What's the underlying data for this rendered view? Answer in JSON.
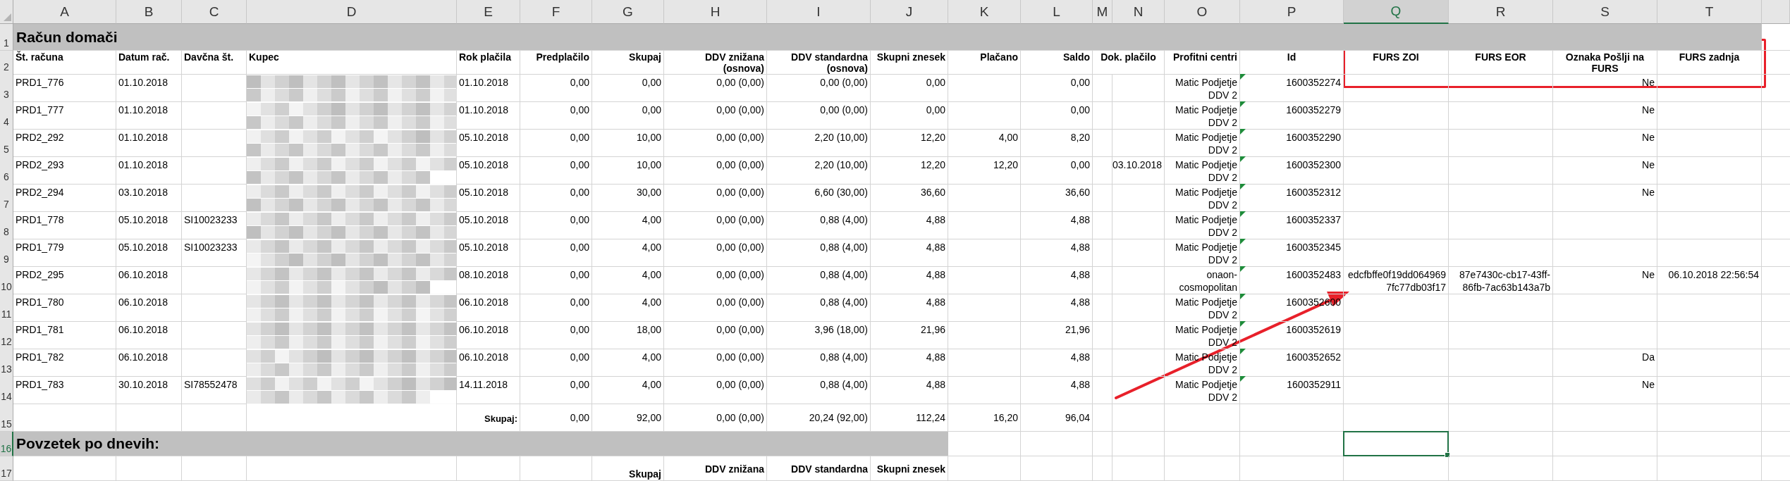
{
  "column_headers": [
    {
      "label": "A",
      "selected": false
    },
    {
      "label": "B",
      "selected": false
    },
    {
      "label": "C",
      "selected": false
    },
    {
      "label": "D",
      "selected": false
    },
    {
      "label": "E",
      "selected": false
    },
    {
      "label": "F",
      "selected": false
    },
    {
      "label": "G",
      "selected": false
    },
    {
      "label": "H",
      "selected": false
    },
    {
      "label": "I",
      "selected": false
    },
    {
      "label": "J",
      "selected": false
    },
    {
      "label": "K",
      "selected": false
    },
    {
      "label": "L",
      "selected": false
    },
    {
      "label": "M",
      "selected": false
    },
    {
      "label": "N",
      "selected": false
    },
    {
      "label": "O",
      "selected": false
    },
    {
      "label": "P",
      "selected": false
    },
    {
      "label": "Q",
      "selected": true
    },
    {
      "label": "R",
      "selected": false
    },
    {
      "label": "S",
      "selected": false
    },
    {
      "label": "T",
      "selected": false
    }
  ],
  "row_numbers": [
    {
      "label": "1",
      "selected": false
    },
    {
      "label": "2",
      "selected": false
    },
    {
      "label": "3",
      "selected": false
    },
    {
      "label": "4",
      "selected": false
    },
    {
      "label": "5",
      "selected": false
    },
    {
      "label": "6",
      "selected": false
    },
    {
      "label": "7",
      "selected": false
    },
    {
      "label": "8",
      "selected": false
    },
    {
      "label": "9",
      "selected": false
    },
    {
      "label": "10",
      "selected": false
    },
    {
      "label": "11",
      "selected": false
    },
    {
      "label": "12",
      "selected": false
    },
    {
      "label": "13",
      "selected": false
    },
    {
      "label": "14",
      "selected": false
    },
    {
      "label": "15",
      "selected": false
    },
    {
      "label": "16",
      "selected": true
    },
    {
      "label": "17",
      "selected": false
    }
  ],
  "title": "Račun domači",
  "header": {
    "A": "Št. računa",
    "B": "Datum rač.",
    "C": "Davčna št.",
    "D": "Kupec",
    "E": "Rok plačila",
    "F": "Predplačilo",
    "G": "Skupaj",
    "H": "DDV znižana (osnova)",
    "I": "DDV standardna (osnova)",
    "J": "Skupni znesek",
    "K": "Plačano",
    "L": "Saldo",
    "M": "Dok. plačilo",
    "O": "Profitni centri",
    "P": "Id",
    "Q": "FURS ZOI",
    "R": "FURS EOR",
    "S": "Oznaka Pošlji na FURS",
    "T": "FURS zadnja"
  },
  "rows": [
    {
      "A": "PRD1_776",
      "B": "01.10.2018",
      "D": {
        "kind": "redacted"
      },
      "E": "01.10.2018",
      "F": "0,00",
      "G": "0,00",
      "H": "0,00 (0,00)",
      "I": "0,00 (0,00)",
      "J": "0,00",
      "L": "0,00",
      "O": "Matic Podjetje DDV 2",
      "P": "1600352274",
      "id_warning": true,
      "S": "Ne"
    },
    {
      "A": "PRD1_777",
      "B": "01.10.2018",
      "D": {
        "kind": "redacted"
      },
      "E": "01.10.2018",
      "F": "0,00",
      "G": "0,00",
      "H": "0,00 (0,00)",
      "I": "0,00 (0,00)",
      "J": "0,00",
      "L": "0,00",
      "O": "Matic Podjetje DDV 2",
      "P": "1600352279",
      "id_warning": true,
      "S": "Ne"
    },
    {
      "A": "PRD2_292",
      "B": "01.10.2018",
      "D": {
        "kind": "redacted"
      },
      "E": "05.10.2018",
      "F": "0,00",
      "G": "10,00",
      "H": "0,00 (0,00)",
      "I": "2,20 (10,00)",
      "J": "12,20",
      "K": "4,00",
      "L": "8,20",
      "O": "Matic Podjetje DDV 2",
      "P": "1600352290",
      "id_warning": true,
      "S": "Ne"
    },
    {
      "A": "PRD2_293",
      "B": "01.10.2018",
      "D": {
        "kind": "redacted"
      },
      "E": "05.10.2018",
      "F": "0,00",
      "G": "10,00",
      "H": "0,00 (0,00)",
      "I": "2,20 (10,00)",
      "J": "12,20",
      "K": "12,20",
      "L": "0,00",
      "N": "03.10.2018",
      "O": "Matic Podjetje DDV 2",
      "P": "1600352300",
      "id_warning": true,
      "S": "Ne"
    },
    {
      "A": "PRD2_294",
      "B": "03.10.2018",
      "D": {
        "kind": "redacted"
      },
      "E": "05.10.2018",
      "F": "0,00",
      "G": "30,00",
      "H": "0,00 (0,00)",
      "I": "6,60 (30,00)",
      "J": "36,60",
      "L": "36,60",
      "O": "Matic Podjetje DDV 2",
      "P": "1600352312",
      "id_warning": true,
      "S": "Ne"
    },
    {
      "A": "PRD1_778",
      "B": "05.10.2018",
      "C": "SI10023233",
      "D": {
        "kind": "redacted"
      },
      "E": "05.10.2018",
      "F": "0,00",
      "G": "4,00",
      "H": "0,00 (0,00)",
      "I": "0,88 (4,00)",
      "J": "4,88",
      "L": "4,88",
      "O": "Matic Podjetje DDV 2",
      "P": "1600352337",
      "id_warning": true
    },
    {
      "A": "PRD1_779",
      "B": "05.10.2018",
      "C": "SI10023233",
      "D": {
        "kind": "redacted"
      },
      "E": "05.10.2018",
      "F": "0,00",
      "G": "4,00",
      "H": "0,00 (0,00)",
      "I": "0,88 (4,00)",
      "J": "4,88",
      "L": "4,88",
      "O": "Matic Podjetje DDV 2",
      "P": "1600352345",
      "id_warning": true
    },
    {
      "A": "PRD2_295",
      "B": "06.10.2018",
      "D": {
        "kind": "redacted"
      },
      "E": "08.10.2018",
      "F": "0,00",
      "G": "4,00",
      "H": "0,00 (0,00)",
      "I": "0,88 (4,00)",
      "J": "4,88",
      "L": "4,88",
      "O": "onaon-cosmopolitan",
      "P": "1600352483",
      "id_warning": true,
      "Q": "edcfbffe0f19dd0649697fc77db03f17",
      "R": "87e7430c-cb17-43ff-86fb-7ac63b143a7b",
      "S": "Ne",
      "T": "06.10.2018 22:56:54"
    },
    {
      "A": "PRD1_780",
      "B": "06.10.2018",
      "D": {
        "kind": "redacted"
      },
      "E": "06.10.2018",
      "F": "0,00",
      "G": "4,00",
      "H": "0,00 (0,00)",
      "I": "0,88 (4,00)",
      "J": "4,88",
      "L": "4,88",
      "O": "Matic Podjetje DDV 2",
      "P": "1600352600",
      "id_warning": true
    },
    {
      "A": "PRD1_781",
      "B": "06.10.2018",
      "D": {
        "kind": "redacted"
      },
      "E": "06.10.2018",
      "F": "0,00",
      "G": "18,00",
      "H": "0,00 (0,00)",
      "I": "3,96 (18,00)",
      "J": "21,96",
      "L": "21,96",
      "O": "Matic Podjetje DDV 2",
      "P": "1600352619",
      "id_warning": true
    },
    {
      "A": "PRD1_782",
      "B": "06.10.2018",
      "D": {
        "kind": "redacted"
      },
      "E": "06.10.2018",
      "F": "0,00",
      "G": "4,00",
      "H": "0,00 (0,00)",
      "I": "0,88 (4,00)",
      "J": "4,88",
      "L": "4,88",
      "O": "Matic Podjetje DDV 2",
      "P": "1600352652",
      "id_warning": true,
      "S": "Da"
    },
    {
      "A": "PRD1_783",
      "B": "30.10.2018",
      "C": "SI78552478",
      "D": {
        "kind": "redacted"
      },
      "E": "14.11.2018",
      "F": "0,00",
      "G": "4,00",
      "H": "0,00 (0,00)",
      "I": "0,88 (4,00)",
      "J": "4,88",
      "L": "4,88",
      "O": "Matic Podjetje DDV 2",
      "P": "1600352911",
      "id_warning": true,
      "S": "Ne"
    }
  ],
  "totals": {
    "E": "Skupaj:",
    "F": "0,00",
    "G": "92,00",
    "H": "0,00 (0,00)",
    "I": "20,24 (92,00)",
    "J": "112,24",
    "K": "16,20",
    "L": "96,04"
  },
  "summary": {
    "title": "Povzetek po dnevih:",
    "header": {
      "G": "Skupaj",
      "H": "DDV znižana",
      "I": "DDV standardna",
      "J": "Skupni znesek"
    }
  },
  "annotations": {
    "highlight_box": true,
    "arrow": true
  }
}
